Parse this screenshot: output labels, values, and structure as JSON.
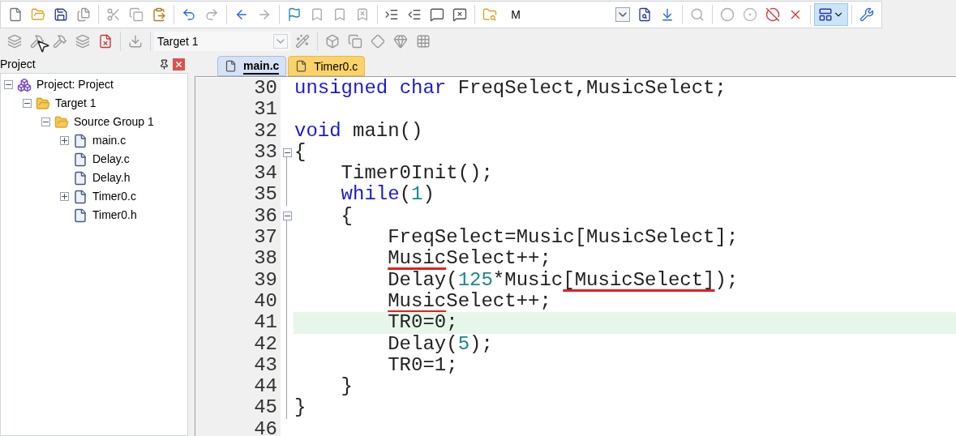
{
  "toolbar": {
    "find_text": "M"
  },
  "build_toolbar": {
    "target": "Target 1"
  },
  "project_panel": {
    "title": "Project",
    "tree": [
      {
        "label": "Project: Project",
        "kind": "project",
        "expanded": true,
        "children": [
          {
            "label": "Target 1",
            "kind": "target",
            "expanded": true,
            "children": [
              {
                "label": "Source Group 1",
                "kind": "group",
                "expanded": true,
                "children": [
                  {
                    "label": "main.c",
                    "kind": "file",
                    "expanded": false
                  },
                  {
                    "label": "Delay.c",
                    "kind": "file"
                  },
                  {
                    "label": "Delay.h",
                    "kind": "file"
                  },
                  {
                    "label": "Timer0.c",
                    "kind": "file",
                    "expanded": false
                  },
                  {
                    "label": "Timer0.h",
                    "kind": "file"
                  }
                ]
              }
            ]
          }
        ]
      }
    ]
  },
  "tabs": [
    {
      "label": "main.c",
      "selected": true
    },
    {
      "label": "Timer0.c",
      "selected": false
    }
  ],
  "editor": {
    "lines": [
      {
        "number": "30",
        "current": false,
        "tokens": [
          {
            "t": "unsigned",
            "color": "#1a1ad0"
          },
          {
            "t": " char",
            "color": "#1a1ad0"
          },
          {
            "t": " FreqSelect,MusicSelect;"
          }
        ]
      },
      {
        "number": "31",
        "current": false
      },
      {
        "number": "32",
        "current": false,
        "tokens": [
          {
            "t": "void",
            "color": "#1a1ad0"
          },
          {
            "t": " main()"
          }
        ]
      },
      {
        "number": "33",
        "current": false,
        "fold": true,
        "tokens": [
          {
            "t": "{"
          }
        ]
      },
      {
        "number": "34",
        "current": false,
        "tokens": [
          {
            "t": "    Timer0Init();"
          }
        ]
      },
      {
        "number": "35",
        "current": false,
        "tokens": [
          {
            "t": "    while",
            "color": "#1a1ad0"
          },
          {
            "t": "("
          },
          {
            "t": "1",
            "color": "#1a8a8a"
          },
          {
            "t": ")"
          }
        ]
      },
      {
        "number": "36",
        "current": false,
        "fold": true,
        "tokens": [
          {
            "t": "    {"
          }
        ]
      },
      {
        "number": "37",
        "current": false,
        "tokens": [
          {
            "t": "        FreqSelect=Music[MusicSelect];"
          }
        ]
      },
      {
        "number": "38",
        "current": false,
        "tokens": [
          {
            "t": "        Music",
            "underlined": true
          },
          {
            "t": "Select++;"
          }
        ]
      },
      {
        "number": "39",
        "current": false,
        "tokens": [
          {
            "t": "        Delay("
          },
          {
            "t": "125",
            "color": "#1a8a8a"
          },
          {
            "t": "*Music"
          },
          {
            "t": "[MusicSelect]",
            "underlined": true
          },
          {
            "t": ");"
          }
        ]
      },
      {
        "number": "40",
        "current": false,
        "tokens": [
          {
            "t": "        Music",
            "underlined": true
          },
          {
            "t": "Select++;"
          }
        ]
      },
      {
        "number": "41",
        "current": true,
        "tokens": [
          {
            "t": "        TR0=0;"
          }
        ]
      },
      {
        "number": "42",
        "current": false,
        "tokens": [
          {
            "t": "        Delay("
          },
          {
            "t": "5",
            "color": "#1a8a8a"
          },
          {
            "t": ");"
          }
        ]
      },
      {
        "number": "43",
        "current": false,
        "tokens": [
          {
            "t": "        TR0=1;"
          }
        ]
      },
      {
        "number": "44",
        "current": false,
        "tokens": [
          {
            "t": "    }"
          }
        ]
      },
      {
        "number": "45",
        "current": false,
        "tokens": [
          {
            "t": "}"
          }
        ]
      },
      {
        "number": "46",
        "current": false
      }
    ]
  }
}
